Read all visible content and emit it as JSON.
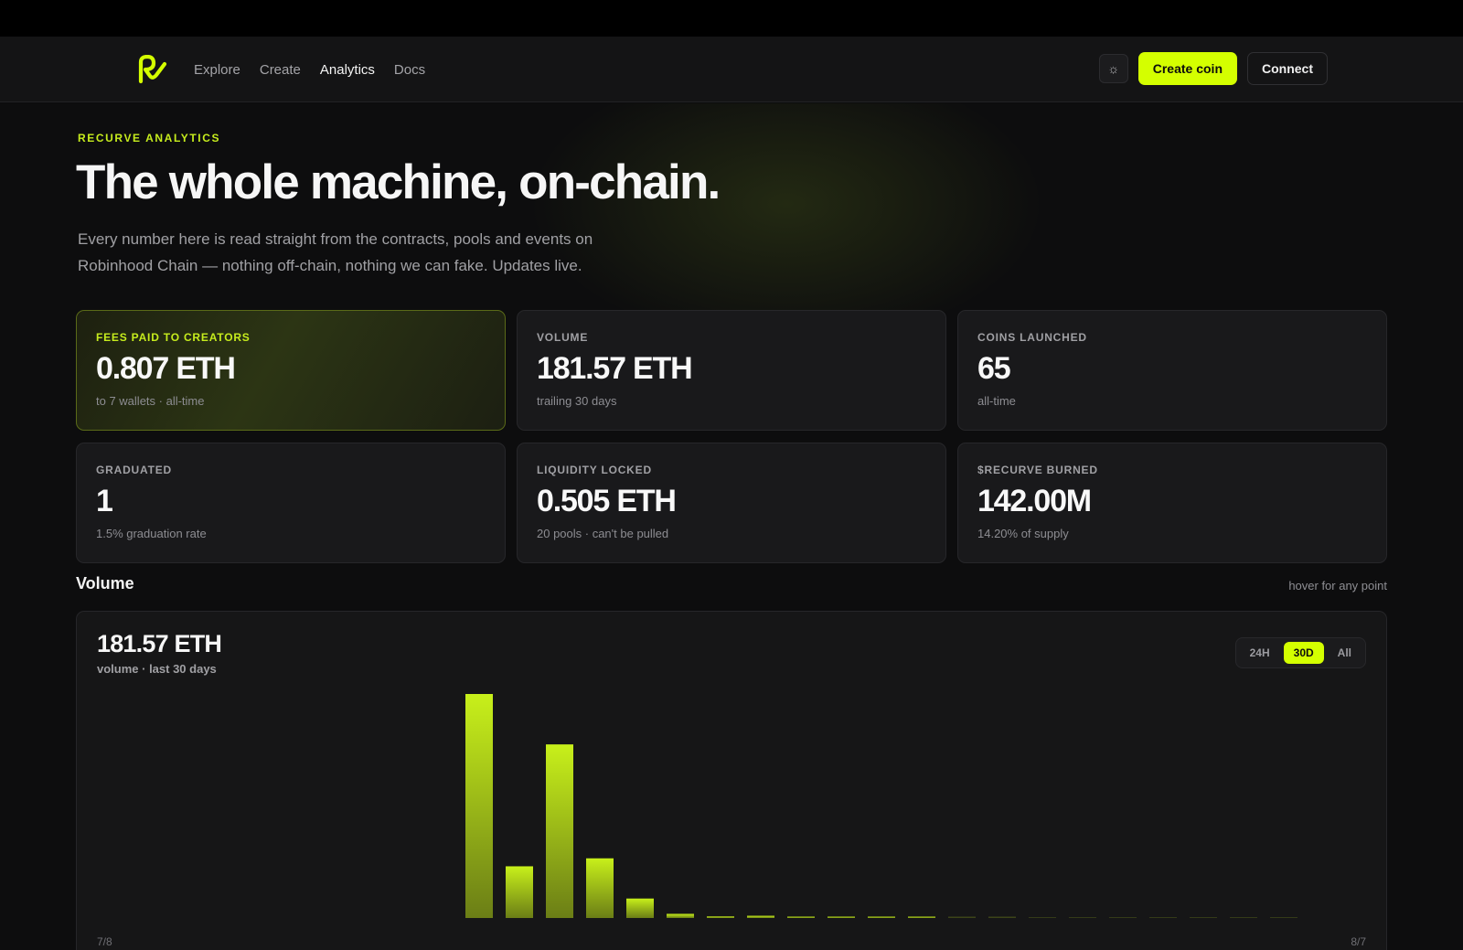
{
  "nav": {
    "links": [
      {
        "label": "Explore",
        "active": false
      },
      {
        "label": "Create",
        "active": false
      },
      {
        "label": "Analytics",
        "active": true
      },
      {
        "label": "Docs",
        "active": false
      }
    ],
    "theme_icon": "sun-icon",
    "create_label": "Create coin",
    "connect_label": "Connect"
  },
  "hero": {
    "eyebrow": "RECURVE ANALYTICS",
    "title": "The whole machine, on-chain.",
    "subtitle": "Every number here is read straight from the contracts, pools and events on Robinhood Chain — nothing off-chain, nothing we can fake. Updates live."
  },
  "stats": [
    {
      "label": "FEES PAID TO CREATORS",
      "value": "0.807 ETH",
      "sub": "to 7 wallets · all-time"
    },
    {
      "label": "VOLUME",
      "value": "181.57 ETH",
      "sub": "trailing 30 days"
    },
    {
      "label": "COINS LAUNCHED",
      "value": "65",
      "sub": "all-time"
    },
    {
      "label": "GRADUATED",
      "value": "1",
      "sub": "1.5% graduation rate"
    },
    {
      "label": "LIQUIDITY LOCKED",
      "value": "0.505 ETH",
      "sub": "20 pools · can't be pulled"
    },
    {
      "label": "$RECURVE BURNED",
      "value": "142.00M",
      "sub": "14.20% of supply"
    }
  ],
  "volume": {
    "title": "Volume",
    "hint": "hover for any point",
    "total": "181.57 ETH",
    "caption": "volume · last 30 days",
    "ranges": [
      {
        "label": "24H",
        "active": false
      },
      {
        "label": "30D",
        "active": true
      },
      {
        "label": "All",
        "active": false
      }
    ]
  },
  "colors": {
    "accent": "#d4ff00",
    "bar_top": "#c8f01a",
    "bar_bottom": "#6b7e16"
  },
  "chart_data": {
    "type": "bar",
    "x_start_label": "7/8",
    "x_end_label": "8/7",
    "values": [
      0,
      0,
      0,
      0,
      0,
      0,
      0,
      0,
      0,
      0,
      70.2,
      16.2,
      54.4,
      18.7,
      6.1,
      1.3,
      0.5,
      0.7,
      0.2,
      0.2,
      0.4,
      0.2,
      0.1,
      0.1,
      0,
      0,
      0,
      0,
      0,
      0,
      0
    ],
    "ylim": [
      0,
      70.2
    ],
    "grid": false
  }
}
